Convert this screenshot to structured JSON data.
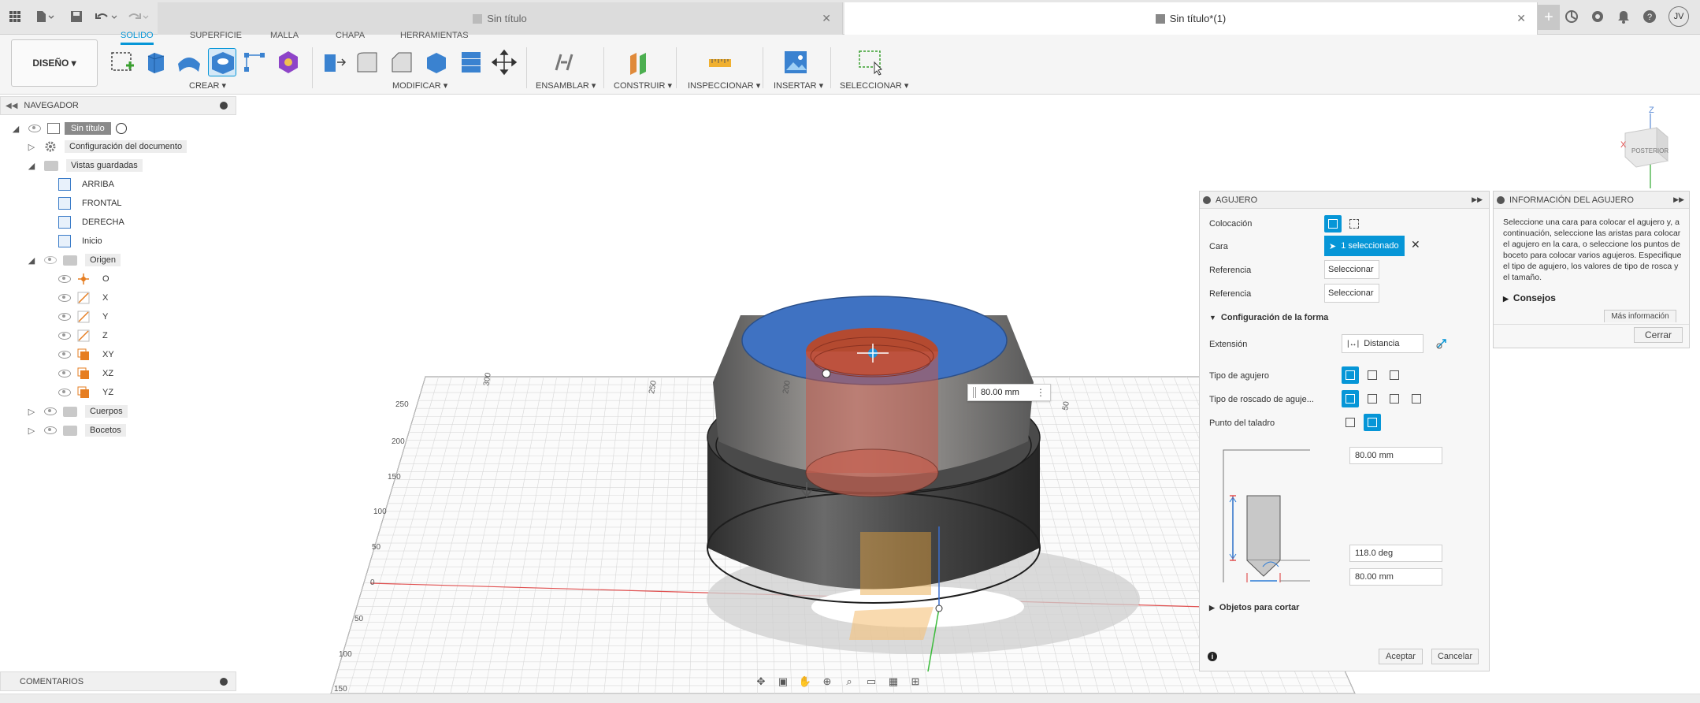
{
  "app": {
    "tabs": [
      {
        "label": "Sin título",
        "active": false
      },
      {
        "label": "Sin título*(1)",
        "active": true
      }
    ],
    "user_initials": "JV"
  },
  "toolbar": {
    "workspace": "DISEÑO ▾",
    "tabs": [
      "SOLIDO",
      "SUPERFICIE",
      "MALLA",
      "CHAPA",
      "HERRAMIENTAS"
    ],
    "active_tab": "SOLIDO",
    "groups": [
      "CREAR ▾",
      "MODIFICAR ▾",
      "ENSAMBLAR ▾",
      "CONSTRUIR ▾",
      "INSPECCIONAR ▾",
      "INSERTAR ▾",
      "SELECCIONAR ▾"
    ],
    "accent": "#0696d7"
  },
  "navigator": {
    "title": "NAVEGADOR",
    "root": "Sin título",
    "doc_settings": "Configuración del documento",
    "saved_views": "Vistas guardadas",
    "views": [
      "ARRIBA",
      "FRONTAL",
      "DERECHA",
      "Inicio"
    ],
    "origin": "Origen",
    "origin_items": [
      "O",
      "X",
      "Y",
      "Z",
      "XY",
      "XZ",
      "YZ"
    ],
    "bodies": "Cuerpos",
    "sketches": "Bocetos"
  },
  "viewport": {
    "viewcube_label": "POSTERIOR",
    "axis_z": "Z",
    "axis_x": "X",
    "dimension_callout": "80.00 mm",
    "grid_labels_left": [
      "250",
      "200",
      "150",
      "100",
      "50",
      "0",
      "50",
      "100",
      "150"
    ],
    "grid_labels_top": [
      "300",
      "250",
      "200",
      "50"
    ]
  },
  "hole_panel": {
    "title": "AGUJERO",
    "placement_label": "Colocación",
    "face_label": "Cara",
    "face_value": "1 seleccionado",
    "ref1_label": "Referencia",
    "ref1_value": "Seleccionar",
    "ref2_label": "Referencia",
    "ref2_value": "Seleccionar",
    "shape_section": "Configuración de la forma",
    "extent_label": "Extensión",
    "extent_value": "Distancia",
    "hole_type_label": "Tipo de agujero",
    "tap_type_label": "Tipo de roscado de aguje...",
    "drill_point_label": "Punto del taladro",
    "depth_value": "80.00 mm",
    "angle_value": "118.0 deg",
    "diameter_value": "80.00 mm",
    "objects_section": "Objetos para cortar",
    "ok": "Aceptar",
    "cancel": "Cancelar"
  },
  "info_panel": {
    "title": "INFORMACIÓN DEL AGUJERO",
    "text": "Seleccione una cara para colocar el agujero y, a continuación, seleccione las aristas para colocar el agujero en la cara, o seleccione los puntos de boceto para colocar varios agujeros. Especifique el tipo de agujero, los valores de tipo de rosca y el tamaño.",
    "tips": "Consejos",
    "more": "Más información",
    "close": "Cerrar"
  },
  "comments": {
    "title": "COMENTARIOS"
  }
}
